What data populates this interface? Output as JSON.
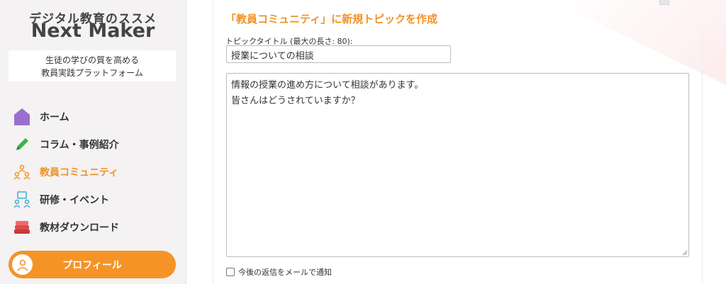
{
  "sidebar": {
    "tagline": "デジタル教育のススメ",
    "brand": "Next Maker",
    "desc_line1": "生徒の学びの質を高める",
    "desc_line2": "教員実践プラットフォーム",
    "nav": [
      {
        "label": "ホーム",
        "icon": "home-icon",
        "color": "#9b6fd1"
      },
      {
        "label": "コラム・事例紹介",
        "icon": "pencil-icon",
        "color": "#3cb54a"
      },
      {
        "label": "教員コミュニティ",
        "icon": "community-icon",
        "color": "#f39224",
        "active": true
      },
      {
        "label": "研修・イベント",
        "icon": "event-icon",
        "color": "#3ab0d8"
      },
      {
        "label": "教材ダウンロード",
        "icon": "books-icon",
        "color": "#e04b4b"
      }
    ],
    "profile_label": "プロフィール"
  },
  "form": {
    "heading": "「教員コミュニティ」に新規トピックを作成",
    "title_label": "トピックタイトル (最大の長さ: 80):",
    "title_value": "授業についての相談",
    "body_value": "情報の授業の進め方について相談があります。\n皆さんはどうされていますか？",
    "notify_label": "今後の返信をメールで通知"
  },
  "colors": {
    "accent": "#f39224",
    "sidebar_bg": "#f4f2f2"
  }
}
